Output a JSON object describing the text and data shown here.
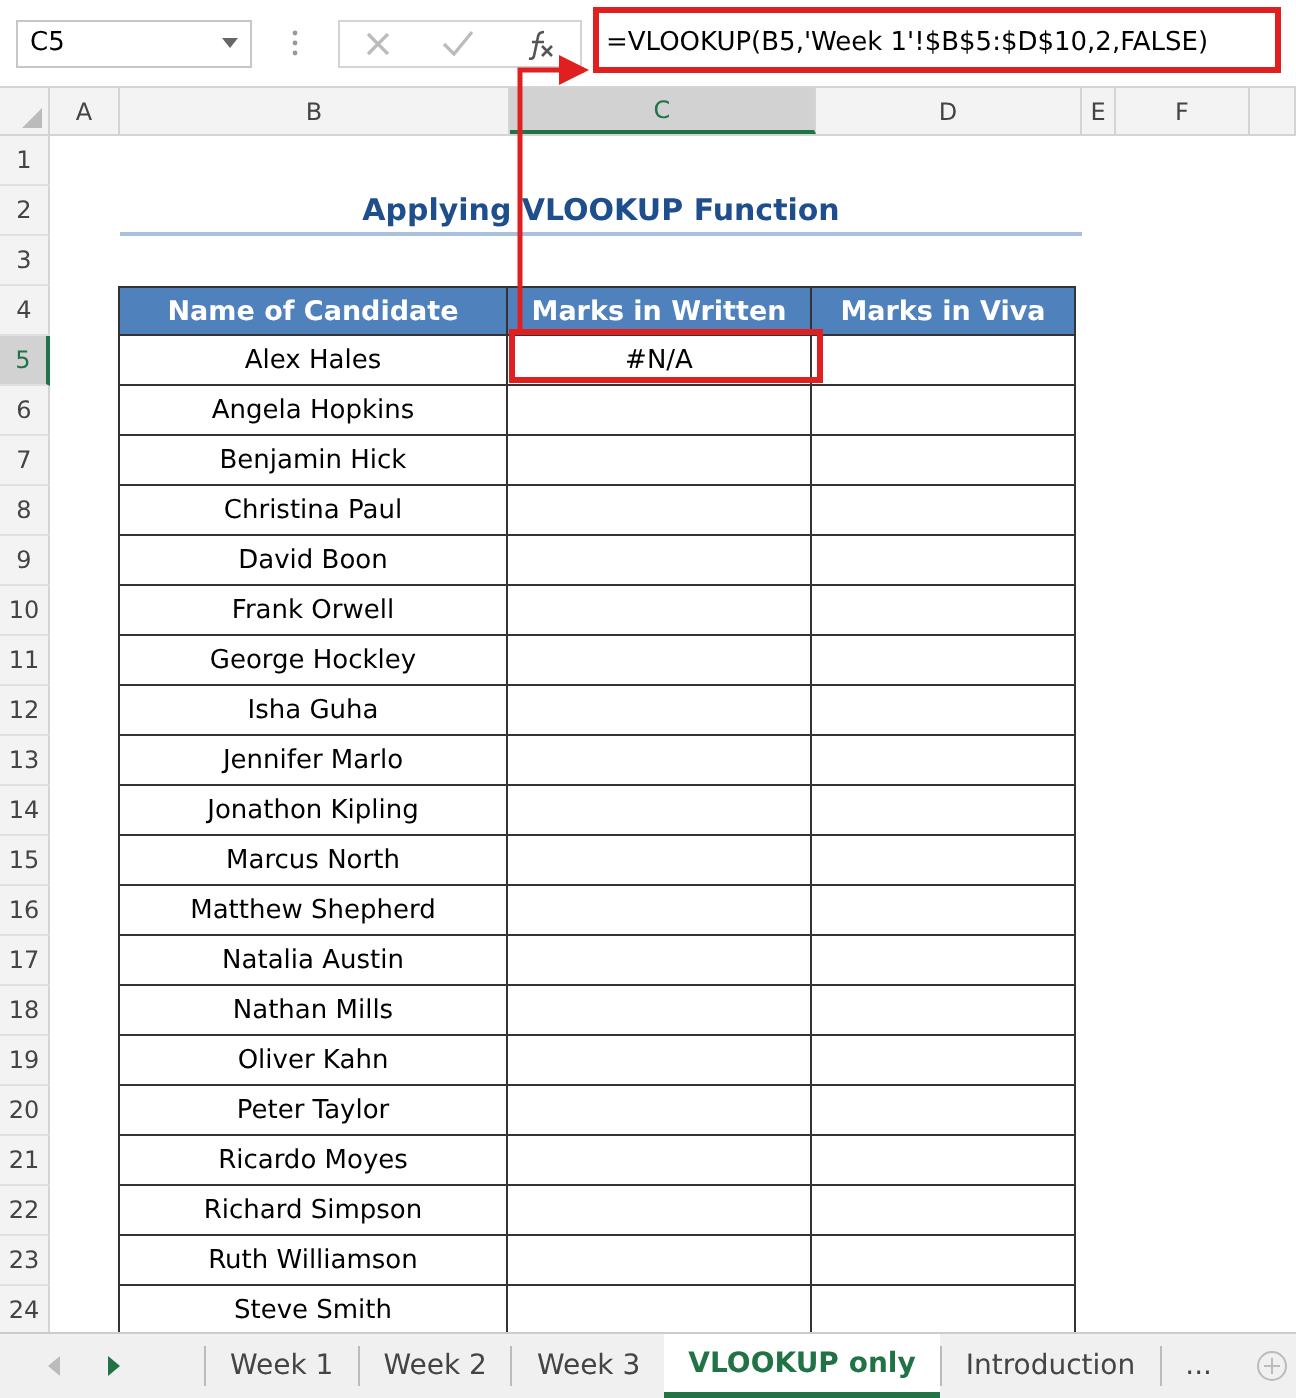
{
  "formula_bar": {
    "name_box": "C5",
    "formula": "=VLOOKUP(B5,'Week 1'!$B$5:$D$10,2,FALSE)"
  },
  "columns": [
    {
      "label": "A",
      "selected": false
    },
    {
      "label": "B",
      "selected": false
    },
    {
      "label": "C",
      "selected": true
    },
    {
      "label": "D",
      "selected": false
    },
    {
      "label": "E",
      "selected": false
    },
    {
      "label": "F",
      "selected": false
    }
  ],
  "rows": [
    {
      "label": "1",
      "selected": false
    },
    {
      "label": "2",
      "selected": false
    },
    {
      "label": "3",
      "selected": false
    },
    {
      "label": "4",
      "selected": false
    },
    {
      "label": "5",
      "selected": true
    },
    {
      "label": "6",
      "selected": false
    },
    {
      "label": "7",
      "selected": false
    },
    {
      "label": "8",
      "selected": false
    },
    {
      "label": "9",
      "selected": false
    },
    {
      "label": "10",
      "selected": false
    },
    {
      "label": "11",
      "selected": false
    },
    {
      "label": "12",
      "selected": false
    },
    {
      "label": "13",
      "selected": false
    },
    {
      "label": "14",
      "selected": false
    },
    {
      "label": "15",
      "selected": false
    },
    {
      "label": "16",
      "selected": false
    },
    {
      "label": "17",
      "selected": false
    },
    {
      "label": "18",
      "selected": false
    },
    {
      "label": "19",
      "selected": false
    },
    {
      "label": "20",
      "selected": false
    },
    {
      "label": "21",
      "selected": false
    },
    {
      "label": "22",
      "selected": false
    },
    {
      "label": "23",
      "selected": false
    },
    {
      "label": "24",
      "selected": false
    }
  ],
  "title": "Applying VLOOKUP Function",
  "table": {
    "columns": [
      "Name of Candidate",
      "Marks in Written",
      "Marks in Viva"
    ],
    "rows": [
      [
        "Alex Hales",
        "#N/A"
      ],
      [
        "Angela Hopkins"
      ],
      [
        "Benjamin Hick"
      ],
      [
        "Christina Paul"
      ],
      [
        "David Boon"
      ],
      [
        "Frank Orwell"
      ],
      [
        "George Hockley"
      ],
      [
        "Isha Guha"
      ],
      [
        "Jennifer Marlo"
      ],
      [
        "Jonathon Kipling"
      ],
      [
        "Marcus North"
      ],
      [
        "Matthew Shepherd"
      ],
      [
        "Natalia Austin"
      ],
      [
        "Nathan Mills"
      ],
      [
        "Oliver Kahn"
      ],
      [
        "Peter Taylor"
      ],
      [
        "Ricardo Moyes"
      ],
      [
        "Richard Simpson"
      ],
      [
        "Ruth Williamson"
      ],
      [
        "Steve Smith"
      ]
    ]
  },
  "sheet_tabs": [
    {
      "label": "Week 1",
      "selected": false
    },
    {
      "label": "Week 2",
      "selected": false
    },
    {
      "label": "Week 3",
      "selected": false
    },
    {
      "label": "VLOOKUP only",
      "selected": true
    },
    {
      "label": "Introduction",
      "selected": false
    },
    {
      "label": "...",
      "selected": false
    }
  ]
}
